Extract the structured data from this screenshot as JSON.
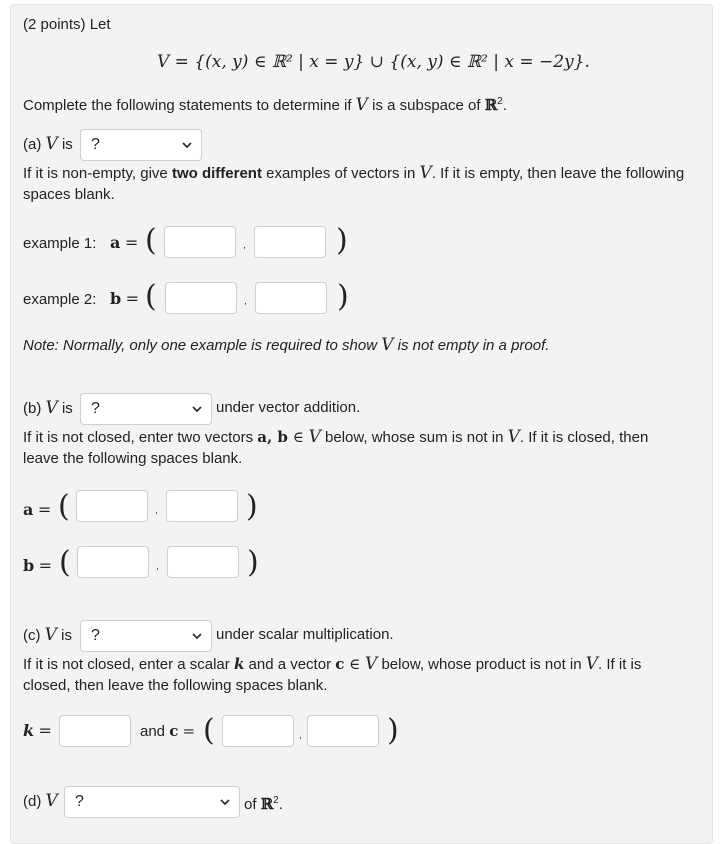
{
  "problem": {
    "points_label": "(2 points) Let",
    "set_definition": {
      "V": "V",
      "eq": " = ",
      "part1": "{(x, y) ∈ ℝ² | x = y}",
      "union": " ∪ ",
      "part2": "{(x, y) ∈ ℝ² | x = −2y}."
    },
    "instruction_pre": "Complete the following statements to determine if ",
    "instruction_V": "V",
    "instruction_post": " is a subspace of ",
    "instruction_R": "ℝ",
    "instruction_sup": "2",
    "instruction_end": "."
  },
  "part_a": {
    "prefix": "(a) ",
    "V": "V",
    "is": " is",
    "select_value": "?",
    "line1_pre": "If it is non-empty, give ",
    "line1_bold": "two different",
    "line1_mid": " examples of vectors in ",
    "line1_V": "V",
    "line1_post": ". If it is empty, then leave the following",
    "line2": "spaces blank.",
    "example1_label": "example 1:",
    "example1_var": "a",
    "example2_label": "example 2:",
    "example2_var": "b",
    "equals": "=",
    "note_pre": "Note: Normally, only one example is required to show ",
    "note_V": "V",
    "note_post": " is not empty in a proof."
  },
  "part_b": {
    "prefix": "(b) ",
    "V": "V",
    "is": " is",
    "select_value": "?",
    "suffix": "under vector addition.",
    "line1_pre": "If it is not closed, enter two vectors ",
    "line1_vars": "a, b",
    "line1_in": " ∈ ",
    "line1_V": "V",
    "line1_mid": " below, whose sum is not in ",
    "line1_V2": "V",
    "line1_post": ". If it is closed, then",
    "line2": "leave the following spaces blank.",
    "var_a": "a",
    "var_b": "b",
    "equals": "="
  },
  "part_c": {
    "prefix": "(c) ",
    "V": "V",
    "is": " is",
    "select_value": "?",
    "suffix": "under scalar multiplication.",
    "line1_pre": "If it is not closed, enter a scalar ",
    "line1_k": "k",
    "line1_mid1": " and a vector ",
    "line1_c": "c",
    "line1_in": " ∈ ",
    "line1_V": "V",
    "line1_mid2": " below, whose product is not in ",
    "line1_V2": "V",
    "line1_post": ". If it is",
    "line2": "closed, then leave the following spaces blank.",
    "var_k": "k",
    "equals": "=",
    "and_label": "and ",
    "var_c": "c"
  },
  "part_d": {
    "prefix": "(d) ",
    "V": "V",
    "select_value": "?",
    "suffix_pre": "of ",
    "suffix_R": "ℝ",
    "suffix_sup": "2",
    "suffix_end": "."
  },
  "symbols": {
    "lparen": "(",
    "rparen": ")",
    "comma": ","
  }
}
